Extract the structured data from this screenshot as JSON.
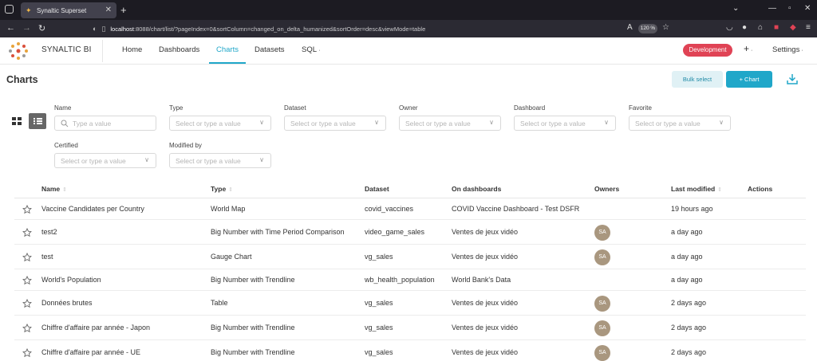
{
  "browser": {
    "tab_title": "Synaltic Superset",
    "url_host": "localhost",
    "url_rest": ":8088/chart/list/?pageIndex=0&sortColumn=changed_on_delta_humanized&sortOrder=desc&viewMode=table",
    "zoom": "120 %"
  },
  "header": {
    "brand": "SYNALTIC BI",
    "menu": [
      "Home",
      "Dashboards",
      "Charts",
      "Datasets",
      "SQL"
    ],
    "env_badge": "Development",
    "plus": "+",
    "settings": "Settings"
  },
  "page": {
    "title": "Charts",
    "bulk_select": "Bulk select",
    "add_chart": "+ Chart"
  },
  "filters": {
    "name_label": "Name",
    "name_placeholder": "Type a value",
    "type_label": "Type",
    "dataset_label": "Dataset",
    "owner_label": "Owner",
    "dashboard_label": "Dashboard",
    "favorite_label": "Favorite",
    "certified_label": "Certified",
    "modified_label": "Modified by",
    "select_placeholder": "Select or type a value"
  },
  "table": {
    "headers": {
      "name": "Name",
      "type": "Type",
      "dataset": "Dataset",
      "dashboards": "On dashboards",
      "owners": "Owners",
      "modified": "Last modified",
      "actions": "Actions"
    },
    "rows": [
      {
        "name": "Vaccine Candidates per Country",
        "type": "World Map",
        "dataset": "covid_vaccines",
        "dashboards": "COVID Vaccine Dashboard - Test DSFR",
        "owner": "",
        "modified": "19 hours ago"
      },
      {
        "name": "test2",
        "type": "Big Number with Time Period Comparison",
        "dataset": "video_game_sales",
        "dashboards": "Ventes de jeux vidéo",
        "owner": "SA",
        "modified": "a day ago"
      },
      {
        "name": "test",
        "type": "Gauge Chart",
        "dataset": "vg_sales",
        "dashboards": "Ventes de jeux vidéo",
        "owner": "SA",
        "modified": "a day ago"
      },
      {
        "name": "World's Population",
        "type": "Big Number with Trendline",
        "dataset": "wb_health_population",
        "dashboards": "World Bank's Data",
        "owner": "",
        "modified": "a day ago"
      },
      {
        "name": "Données brutes",
        "type": "Table",
        "dataset": "vg_sales",
        "dashboards": "Ventes de jeux vidéo",
        "owner": "SA",
        "modified": "2 days ago"
      },
      {
        "name": "Chiffre d'affaire par année - Japon",
        "type": "Big Number with Trendline",
        "dataset": "vg_sales",
        "dashboards": "Ventes de jeux vidéo",
        "owner": "SA",
        "modified": "2 days ago"
      },
      {
        "name": "Chiffre d'affaire par année - UE",
        "type": "Big Number with Trendline",
        "dataset": "vg_sales",
        "dashboards": "Ventes de jeux vidéo",
        "owner": "SA",
        "modified": "2 days ago"
      }
    ]
  },
  "colors": {
    "accent": "#20a7c9",
    "env": "#e04355",
    "avatar": "#a9977f"
  }
}
